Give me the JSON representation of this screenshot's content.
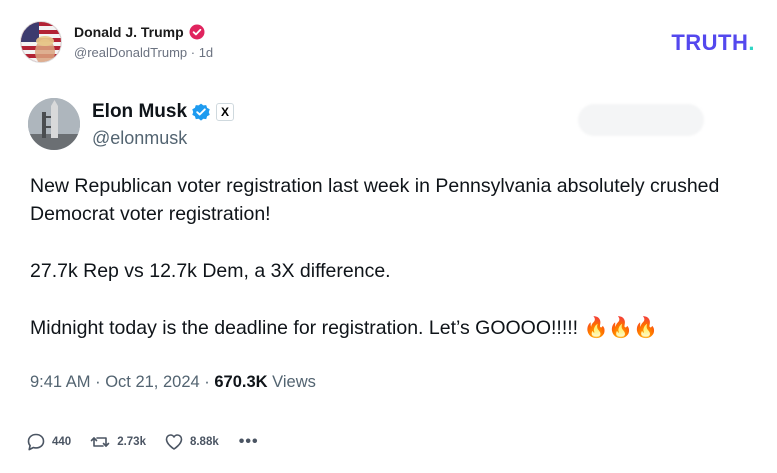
{
  "post": {
    "author_name": "Donald J. Trump",
    "author_handle": "@realDonaldTrump · 1d",
    "brand": "TRUTH",
    "brand_dot": "."
  },
  "tweet": {
    "author_name": "Elon Musk",
    "author_handle": "@elonmusk",
    "x_badge": "X",
    "paragraphs": [
      "New Republican voter registration last week in Pennsylvania absolutely crushed Democrat voter registration!",
      "27.7k Rep vs 12.7k Dem, a 3X difference.",
      "Midnight today is the deadline for registration. Let’s GOOOO!!!!!"
    ],
    "emoji": "🔥🔥🔥",
    "timestamp": "9:41 AM · Oct 21, 2024 · ",
    "views_count": "670.3K",
    "views_label": " Views"
  },
  "actions": {
    "replies": "440",
    "retruths": "2.73k",
    "likes": "8.88k",
    "more": "•••"
  },
  "colors": {
    "brand": "#5448ee",
    "brand_dot": "#2fd6c5",
    "verified_red": "#e0245e",
    "verified_blue": "#1d9bf0"
  }
}
